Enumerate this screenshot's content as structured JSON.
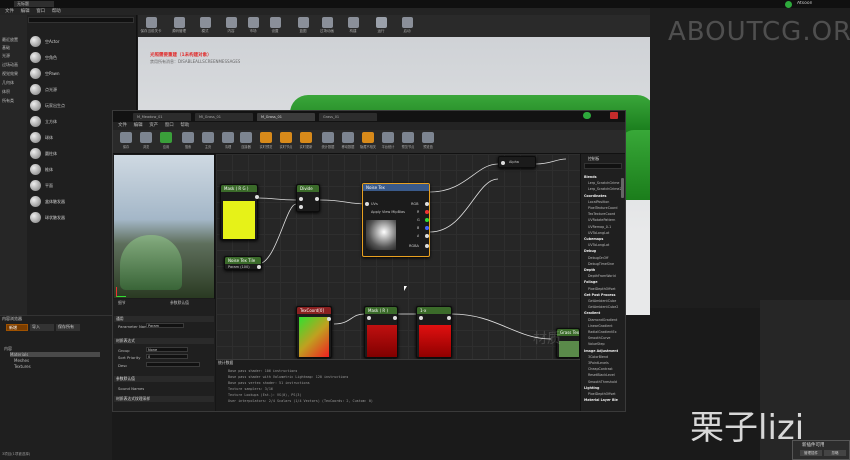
{
  "bg_editor": {
    "menu": [
      "文件",
      "编辑",
      "窗口",
      "帮助"
    ],
    "toolbar": [
      {
        "label": "保存当前关卡",
        "icon": "save-icon"
      },
      {
        "label": "源码管理",
        "icon": "source-control-icon"
      },
      {
        "label": "模式",
        "icon": "modes-icon"
      },
      {
        "label": "内容",
        "icon": "content-icon"
      },
      {
        "label": "市场",
        "icon": "marketplace-icon"
      },
      {
        "label": "设置",
        "icon": "settings-icon"
      },
      {
        "label": "蓝图",
        "icon": "blueprint-icon"
      },
      {
        "label": "过场动画",
        "icon": "cinematics-icon"
      },
      {
        "label": "构建",
        "icon": "build-icon"
      },
      {
        "label": "运行",
        "icon": "play-icon"
      },
      {
        "label": "启动",
        "icon": "launch-icon"
      }
    ],
    "modes": [
      "最近放置",
      "基础",
      "光源",
      "过场动画",
      "视觉效果",
      "几何体",
      "体积",
      "所有类"
    ],
    "place_items": [
      "空Actor",
      "空角色",
      "空Pawn",
      "点光源",
      "玩家出生点",
      "立方体",
      "球体",
      "圆柱体",
      "椎体",
      "平面",
      "盒体触发器",
      "球状触发器"
    ],
    "viewport_warning": "光照需要重建（1未构建对象）",
    "viewport_warning2": "禁用所有消息：DISABLEALLSCREENMESSAGES",
    "watermark": "ABOUTCG.ORG",
    "user": "Atsoon"
  },
  "content_browser": {
    "title": "内容浏览器",
    "add_new": "新增",
    "import": "导入",
    "save_all": "保存所有",
    "tree": [
      "内容",
      "Materials",
      "Meshes",
      "Textures"
    ],
    "status": "3项目(1项被选择)"
  },
  "material_editor": {
    "tabs": [
      "M_Meadow_01",
      "MI_Grass_01",
      "M_Grass_01",
      "Grass_01"
    ],
    "menu": [
      "文件",
      "编辑",
      "资产",
      "窗口",
      "帮助"
    ],
    "toolbar": [
      "保存",
      "浏览",
      "应用",
      "搜索",
      "主页",
      "清理",
      "连接器",
      "实时预览",
      "实时节点",
      "实时更新",
      "统计数据",
      "移动数据",
      "隐藏不相关",
      "平台统计",
      "预览节点",
      "预览值"
    ],
    "details_title": "细节",
    "param_title": "参数默认值",
    "details_rows": [
      {
        "label": "Parameter Name",
        "value": "Param"
      },
      {
        "label": "Group",
        "value": "None"
      },
      {
        "label": "Sort Priority",
        "value": "0"
      },
      {
        "label": "Desc",
        "value": ""
      }
    ],
    "details_heads": [
      "通用",
      "材质表达式",
      "参数默认值",
      "Sound Names",
      "材质表达式纹理采样"
    ],
    "nodes": {
      "mask1": "Mask ( R G )",
      "divide": "Divide",
      "noise_tex": "Noise Tex",
      "noise_param": "Noise Tex Tile",
      "noise_param_sub": "Param (100)",
      "texcoord": "TexCoord[0]",
      "mask2": "Mask ( R )",
      "one_minus": "1-x",
      "alpha": "Alpha",
      "uvs": "UVs",
      "apply_mips": "Apply View MipBias",
      "rgb": "RGB",
      "r": "R",
      "g": "G",
      "b": "B",
      "a": "A",
      "rgba": "RGBA",
      "grass": "Grass Tex"
    },
    "graph_watermark": "材质",
    "results_title": "统计数据",
    "results": [
      "Base pass shader: 106 instructions",
      "Base pass shader with Volumetric Lightmap: 120 instructions",
      "Base pass vertex shader: 51 instructions",
      "Texture samplers: 3/16",
      "Texture Lookups (Est.): VS(0), PS(3)",
      "User interpolators: 2/4 Scalars (1/4 Vectors) (TexCoords: 2, Custom: 0)"
    ],
    "palette_title": "控制板",
    "palette": [
      {
        "t": "Blends",
        "cat": true
      },
      {
        "t": "Lerp_ScratchGrime",
        "cat": false
      },
      {
        "t": "Lerp_ScratchGrime2",
        "cat": false
      },
      {
        "t": "Coordinates",
        "cat": true
      },
      {
        "t": "LocalPosition",
        "cat": false
      },
      {
        "t": "PixelTextureCoord",
        "cat": false
      },
      {
        "t": "TexTextureCoord",
        "cat": false
      },
      {
        "t": "UVRotatePattern",
        "cat": false
      },
      {
        "t": "UVRemap_0-1",
        "cat": false
      },
      {
        "t": "UVToLongLat",
        "cat": false
      },
      {
        "t": "Cubemaps",
        "cat": true
      },
      {
        "t": "UVToLongLat",
        "cat": false
      },
      {
        "t": "Debug",
        "cat": true
      },
      {
        "t": "DebugOnOff",
        "cat": false
      },
      {
        "t": "DebugTimeSine",
        "cat": false
      },
      {
        "t": "Depth",
        "cat": true
      },
      {
        "t": "DepthFromWorld",
        "cat": false
      },
      {
        "t": "Foliage",
        "cat": true
      },
      {
        "t": "PixelDepthOffset",
        "cat": false
      },
      {
        "t": "Get Post Process",
        "cat": true
      },
      {
        "t": "GetAmbientCube",
        "cat": false
      },
      {
        "t": "GetAmbientCube2",
        "cat": false
      },
      {
        "t": "Gradient",
        "cat": true
      },
      {
        "t": "DiamondGradient",
        "cat": false
      },
      {
        "t": "LinearGradient",
        "cat": false
      },
      {
        "t": "RadialGradientEx",
        "cat": false
      },
      {
        "t": "SmoothCurve",
        "cat": false
      },
      {
        "t": "ValueStep",
        "cat": false
      },
      {
        "t": "Image Adjustment",
        "cat": true
      },
      {
        "t": "3ColorBlend",
        "cat": false
      },
      {
        "t": "3PointLevels",
        "cat": false
      },
      {
        "t": "CheapContrast",
        "cat": false
      },
      {
        "t": "ResetBlackLevel",
        "cat": false
      },
      {
        "t": "SmoothThreshold",
        "cat": false
      },
      {
        "t": "Lighting",
        "cat": true
      },
      {
        "t": "PixelDepthOffset",
        "cat": false
      },
      {
        "t": "Material Layer Blend",
        "cat": true
      }
    ]
  },
  "footer": {
    "logo": "栗子lizi",
    "notif_title": "新插件可用",
    "notif_btn": "管理插件",
    "notif_btn2": "忽略"
  }
}
